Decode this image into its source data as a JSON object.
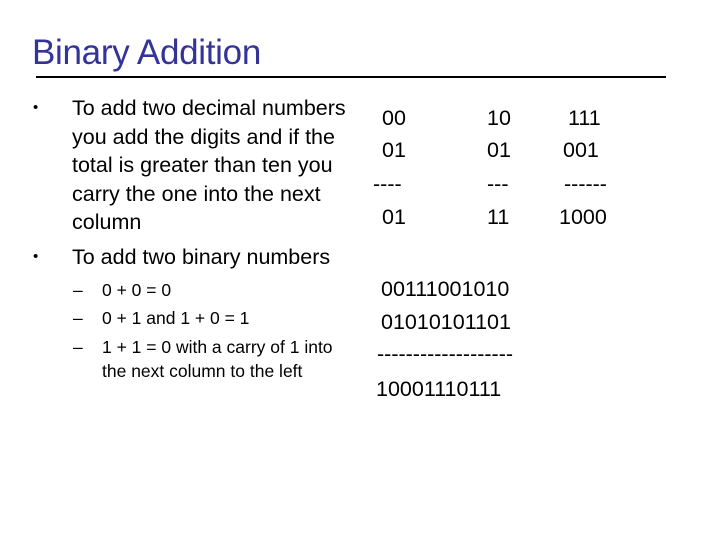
{
  "slide": {
    "title": "Binary Addition",
    "bullets": [
      "To add two decimal numbers you add the digits and if the total is greater than ten you carry the one into the next column",
      "To add two binary numbers"
    ],
    "sub_bullets": [
      "0 + 0 = 0",
      "0 + 1  and 1 + 0 = 1",
      "1 + 1 = 0 with a carry of 1 into the next column to the left"
    ],
    "sub_bullet_marker": "–",
    "examples": [
      {
        "a": "00",
        "b": "01",
        "line": "----",
        "sum": "01"
      },
      {
        "a": "10",
        "b": "01",
        "line": "---",
        "sum": "11"
      },
      {
        "a": "111",
        "b": "001",
        "line": "------",
        "sum": "1000"
      }
    ],
    "long_example": {
      "a": "00111001010",
      "b": "01010101101",
      "line": "-------------------",
      "sum": "10001110111"
    }
  }
}
